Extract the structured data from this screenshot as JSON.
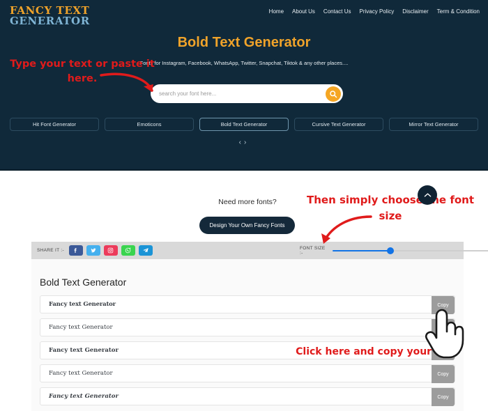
{
  "header": {
    "logo_line1": "FANCY TEXT",
    "logo_line2": "GENERATOR",
    "nav": [
      {
        "label": "Home"
      },
      {
        "label": "About Us"
      },
      {
        "label": "Contact Us"
      },
      {
        "label": "Privacy Policy"
      },
      {
        "label": "Disclaimer"
      },
      {
        "label": "Term & Condition"
      }
    ],
    "title": "Bold Text Generator",
    "subtitle": "Fonts for Instagram, Facebook, WhatsApp, Twitter, Snapchat, Tiktok & any other places....",
    "search": {
      "placeholder": "search your font here...",
      "value": "",
      "button_icon": "search-icon"
    },
    "tabs": [
      {
        "label": "Hit Font Generator",
        "active": false
      },
      {
        "label": "Emoticons",
        "active": false
      },
      {
        "label": "Bold Text Generator",
        "active": true
      },
      {
        "label": "Cursive Text Generator",
        "active": false
      },
      {
        "label": "Mirror Text Generator",
        "active": false
      }
    ],
    "carousel_prev": "‹",
    "carousel_next": "›"
  },
  "promo": {
    "need_more_fonts": "Need more fonts?",
    "design_button": "Design Your Own Fancy Fonts"
  },
  "scroll_top": {
    "icon": "chevron-up-icon"
  },
  "toolbar": {
    "share_label": "SHARE IT :-",
    "socials": [
      {
        "name": "facebook",
        "color": "#3b5998"
      },
      {
        "name": "twitter",
        "color": "#45b0ee"
      },
      {
        "name": "instagram",
        "color": "#ec3b5b"
      },
      {
        "name": "whatsapp",
        "color": "#3ad44f"
      },
      {
        "name": "telegram",
        "color": "#1b94d6"
      }
    ],
    "font_size_label": "FONT SIZE :-",
    "font_size_percent": 33
  },
  "results": {
    "title": "Bold Text Generator",
    "copy_label": "Copy",
    "rows": [
      {
        "text": "Fancy text Generator",
        "style": "st-fraktur"
      },
      {
        "text": "Fancy text Generator",
        "style": "st-outline"
      },
      {
        "text": "Fancy text Generator",
        "style": "st-bold"
      },
      {
        "text": "Fancy text Generator",
        "style": "st-normal"
      },
      {
        "text": "Fancy text Generator",
        "style": "st-bolditalic"
      }
    ]
  },
  "annotations": {
    "note1": "Type your text or paste it here.",
    "note2": "Then simply choose the font size",
    "note3": "Click here and copy your text"
  },
  "colors": {
    "hero_bg": "#10293a",
    "accent_orange": "#f0a32a",
    "logo_blue": "#7fb4d4",
    "annotation_red": "#e01b1b",
    "slider_blue": "#1273e6",
    "copy_gray": "#9c9c9c"
  }
}
